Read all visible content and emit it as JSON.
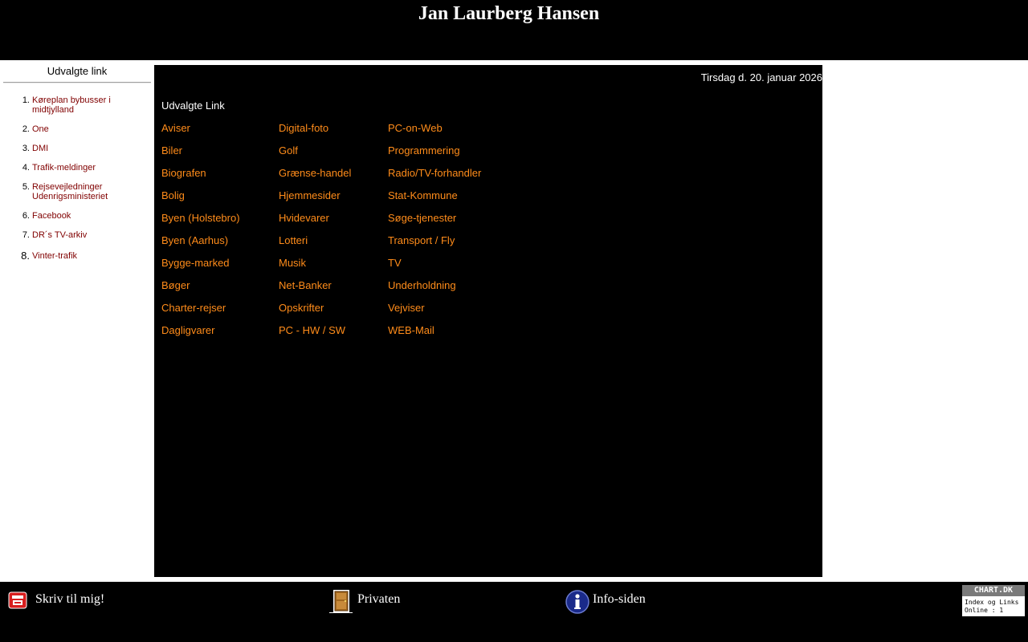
{
  "header": {
    "title": "Jan Laurberg Hansen"
  },
  "sidebar": {
    "title": "Udvalgte link",
    "items": [
      {
        "num": "1.",
        "label": "Køreplan bybusser i midtjylland"
      },
      {
        "num": "2.",
        "label": "One"
      },
      {
        "num": "3.",
        "label": "DMI"
      },
      {
        "num": "4.",
        "label": "Trafik-meldinger"
      },
      {
        "num": "5.",
        "label": "Rejsevejledninger Udenrigsministeriet"
      },
      {
        "num": "6.",
        "label": "Facebook"
      },
      {
        "num": "7.",
        "label": "DR´s TV-arkiv"
      },
      {
        "num": "8.",
        "label": "Vinter-trafik"
      }
    ]
  },
  "main": {
    "date": "Tirsdag d. 20. januar 2026",
    "heading": "Udvalgte Link",
    "columns": [
      [
        "Aviser",
        "Biler",
        "Biografen",
        "Bolig",
        "Byen (Holstebro)",
        "Byen (Aarhus)",
        "Bygge-marked",
        "Bøger",
        "Charter-rejser",
        "Dagligvarer"
      ],
      [
        "Digital-foto",
        "Golf",
        "Grænse-handel",
        "Hjemmesider",
        "Hvidevarer",
        "Lotteri",
        "Musik",
        "Net-Banker",
        "Opskrifter",
        "PC - HW / SW"
      ],
      [
        "PC-on-Web",
        "Programmering",
        "Radio/TV-forhandler",
        "Stat-Kommune",
        "Søge-tjenester",
        "Transport / Fly",
        "TV",
        "Underholdning",
        "Vejviser",
        "WEB-Mail"
      ]
    ]
  },
  "footer": {
    "write_label": "Skriv til mig!",
    "private_label": "Privaten",
    "info_label": "Info-siden",
    "badge": {
      "title": "CHART.DK",
      "line1": "Index og Links",
      "line2": "Online : 1"
    }
  },
  "colors": {
    "link_orange": "#ff8c1a",
    "sidebar_link": "#800000",
    "background_dark": "#000000"
  },
  "icons": [
    "mailbox-icon",
    "door-icon",
    "info-icon"
  ]
}
